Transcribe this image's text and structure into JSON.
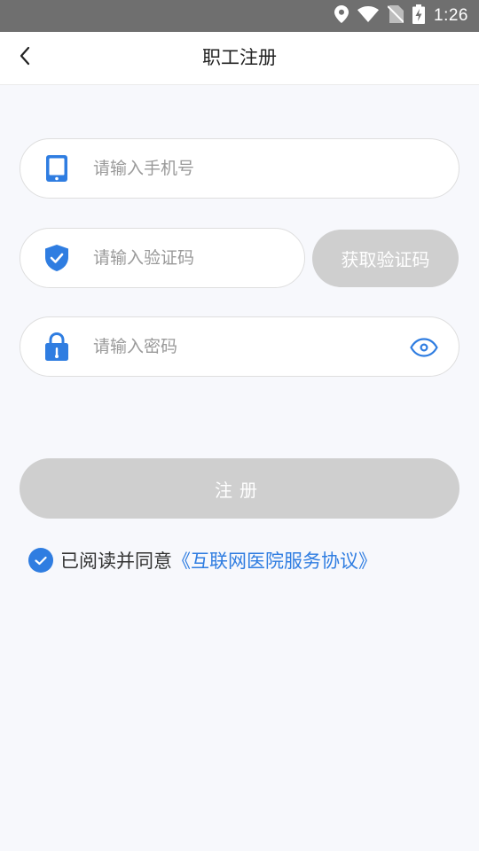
{
  "status_bar": {
    "time": "1:26"
  },
  "header": {
    "title": "职工注册"
  },
  "form": {
    "phone": {
      "value": "",
      "placeholder": "请输入手机号"
    },
    "code": {
      "value": "",
      "placeholder": "请输入验证码",
      "button_label": "获取验证码"
    },
    "password": {
      "value": "",
      "placeholder": "请输入密码"
    }
  },
  "actions": {
    "register_label": "注册"
  },
  "agreement": {
    "checked": true,
    "text": "已阅读并同意",
    "link_text": "《互联网医院服务协议》"
  },
  "colors": {
    "accent": "#2f7de1",
    "disabled_button": "#cfcfcf",
    "page_background": "#f7f8fc",
    "status_bar": "#6f6f6f"
  },
  "icons": {
    "back": "chevron-left-icon",
    "phone": "phone-icon",
    "code": "shield-check-icon",
    "password": "lock-icon",
    "visibility": "eye-icon",
    "agreement": "checkmark-icon",
    "status": [
      "location-icon",
      "wifi-icon",
      "no-sim-icon",
      "battery-charging-icon"
    ]
  }
}
